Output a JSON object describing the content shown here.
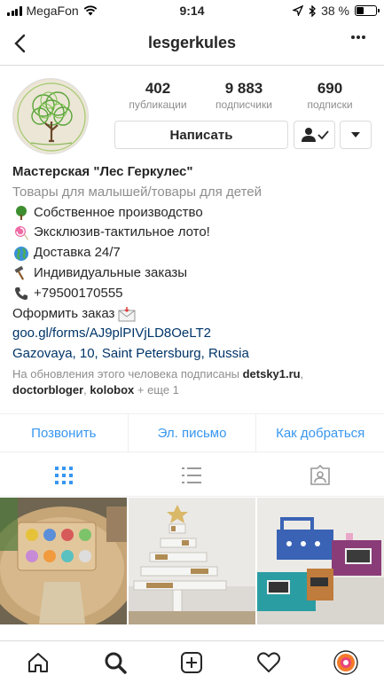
{
  "status_bar": {
    "carrier": "MegaFon",
    "time": "9:14",
    "battery_text": "38 %",
    "battery_level": 0.38
  },
  "nav": {
    "title": "lesgerkules",
    "back_icon": "chevron-left-icon",
    "more_icon": "more-dots-icon"
  },
  "profile": {
    "stats": [
      {
        "value": "402",
        "label": "публикации"
      },
      {
        "value": "9 883",
        "label": "подписчики"
      },
      {
        "value": "690",
        "label": "подписки"
      }
    ],
    "message_button": "Написать",
    "following_icon": "person-check-icon",
    "dropdown_icon": "chevron-down-icon"
  },
  "bio": {
    "name": "Мастерская \"Лес Геркулес\"",
    "category": "Товары для малышей/товары для детей",
    "lines": [
      {
        "emoji": "tree-icon",
        "text": "Собственное производство"
      },
      {
        "emoji": "lollipop-icon",
        "text": "Эксклюзив-тактильное лото!"
      },
      {
        "emoji": "globe-icon",
        "text": "Доставка 24/7"
      },
      {
        "emoji": "hammer-icon",
        "text": "Индивидуальные заказы"
      },
      {
        "emoji": "phone-icon",
        "text": "+79500170555"
      }
    ],
    "order_text": "Оформить заказ",
    "order_emoji": "envelope-icon",
    "link": "goo.gl/forms/AJ9plPIVjLD8OeLT2",
    "address": "Gazovaya, 10, Saint Petersburg, Russia",
    "followed_prefix": "На обновления этого человека подписаны ",
    "followed_user1": "detsky1.ru",
    "followed_comma": ",",
    "followed_user2": "doctorbloger",
    "followed_comma2": ", ",
    "followed_user3": "kolobox",
    "followed_suffix": " + еще 1"
  },
  "contact": {
    "call": "Позвонить",
    "email": "Эл. письмо",
    "directions": "Как добраться"
  },
  "colors": {
    "accent": "#3897f0",
    "link": "#003569",
    "muted": "#8e8e8e",
    "border": "#dbdbdb"
  }
}
